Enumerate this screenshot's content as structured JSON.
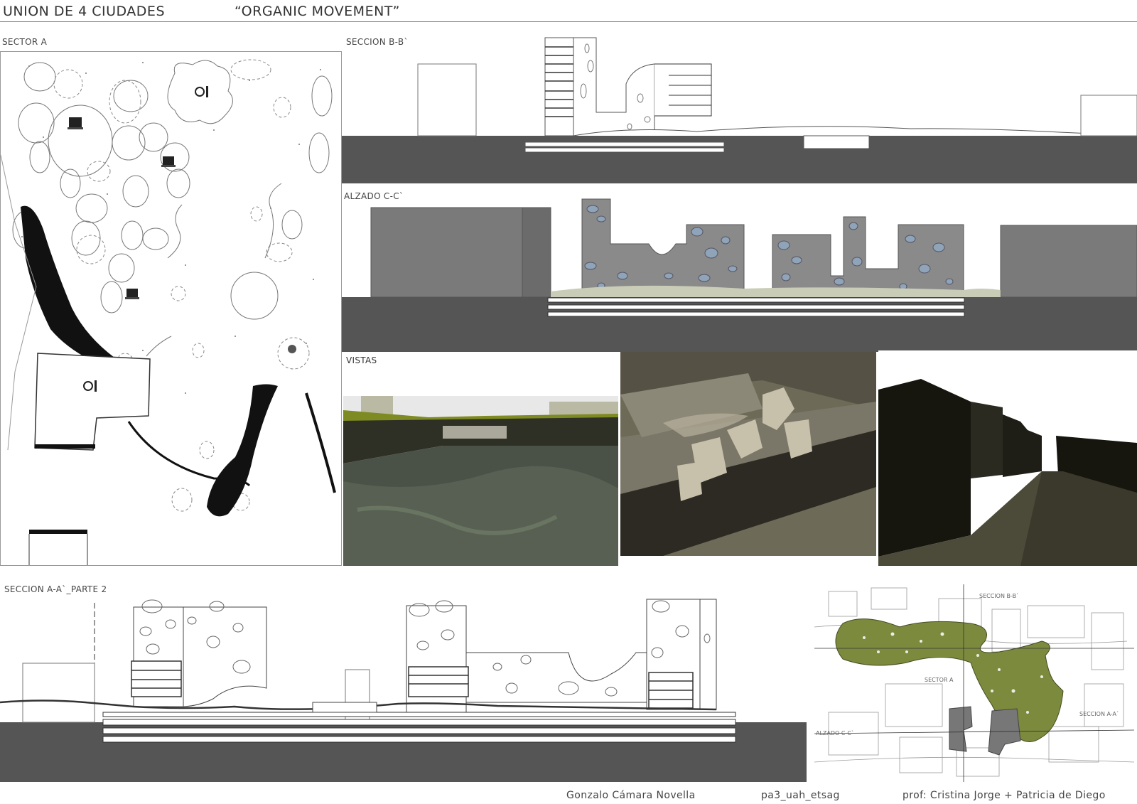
{
  "header": {
    "title": "UNION DE 4 CIUDADES",
    "subtitle": "“ORGANIC MOVEMENT”"
  },
  "panels": {
    "sector_a": "SECTOR A",
    "seccion_bb": "SECCION B-B`",
    "alzado_cc": "ALZADO C-C`",
    "vistas": "VISTAS",
    "seccion_aa": "SECCION A-A`_PARTE 2"
  },
  "key_plan": {
    "labels": {
      "seccion_bb": "SECCION B-B`",
      "sector_a": "SECTOR A",
      "seccion_aa": "SECCION A-A`",
      "alzado_cc": "ALZADO C-C`"
    }
  },
  "footer": {
    "author": "Gonzalo Cámara Novella",
    "course": "pa3_uah_etsag",
    "professors": "prof: Cristina Jorge + Patricia de Diego"
  },
  "colors": {
    "ground": "#555555",
    "facade": "#8a8a8a",
    "window": "#8fa4b8",
    "green": "#7c8a3e",
    "render_dark": "#2b2b24"
  }
}
